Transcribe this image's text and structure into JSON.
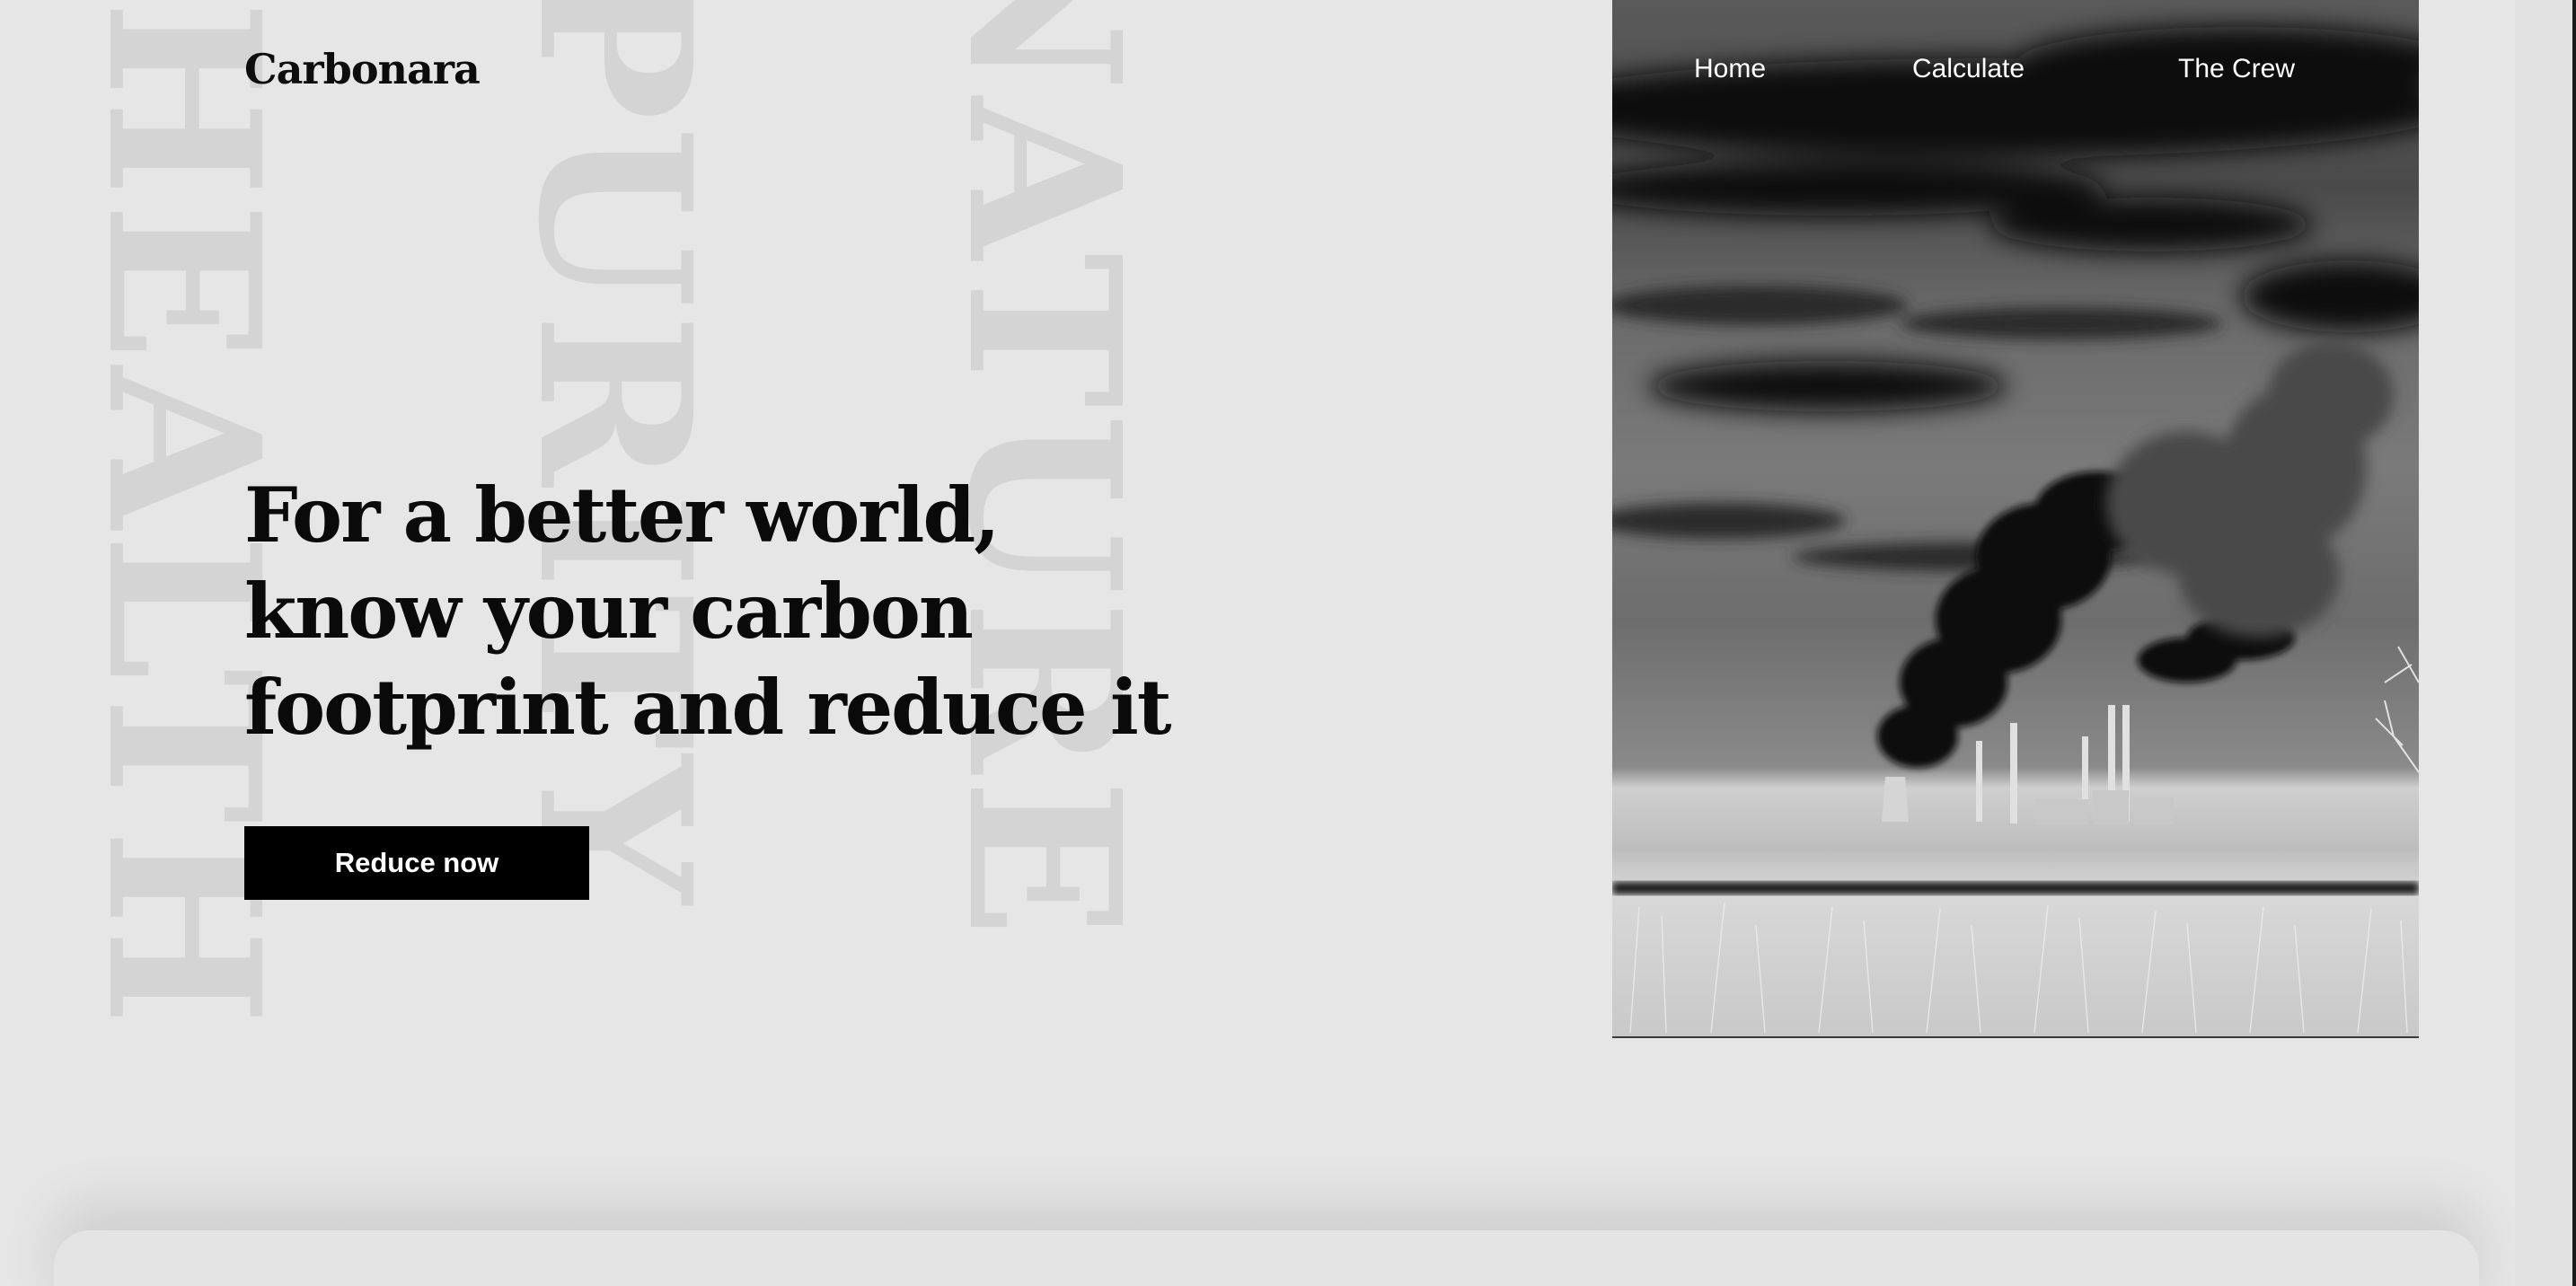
{
  "brand": {
    "name": "Carbonara"
  },
  "nav": {
    "items": [
      {
        "label": "Home"
      },
      {
        "label": "Calculate"
      },
      {
        "label": "The Crew"
      }
    ]
  },
  "hero": {
    "headline": "For a better world, know your carbon footprint and reduce it",
    "cta_label": "Reduce now",
    "image": "inverted-power-plant-smokestacks"
  },
  "watermarks": [
    "HEALTH",
    "PURITY",
    "NATURE"
  ],
  "colors": {
    "background": "#e6e6e6",
    "watermark": "#d4d4d4",
    "text": "#0a0a0a",
    "button": "#000000",
    "button_text": "#ffffff",
    "nav_text": "#ffffff"
  }
}
